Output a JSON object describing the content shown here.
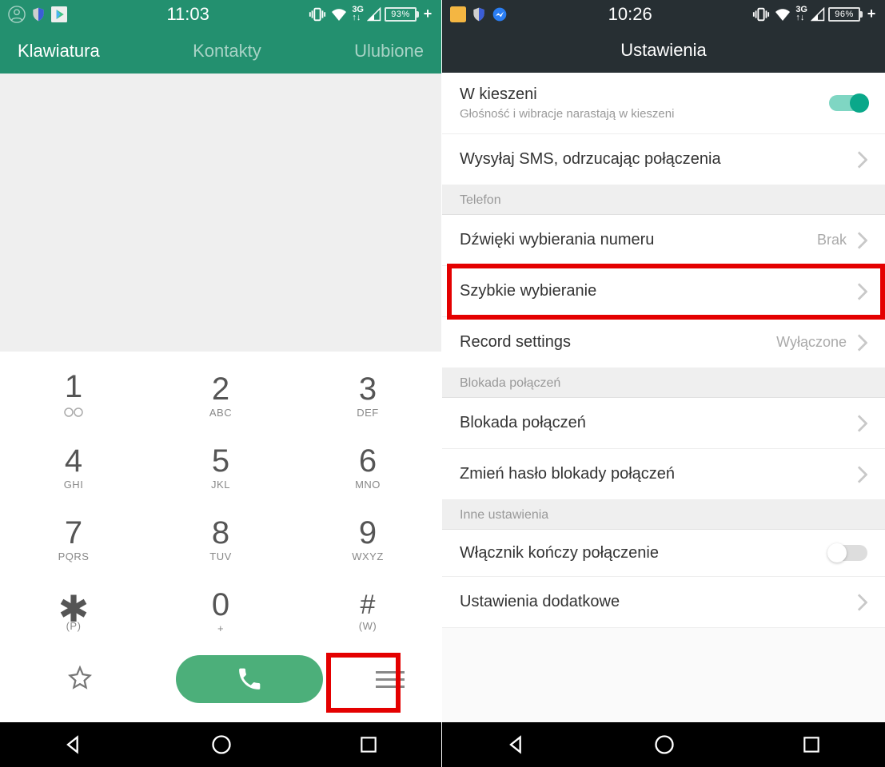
{
  "left": {
    "status": {
      "time": "11:03",
      "battery": "93%"
    },
    "tabs": {
      "t1": "Klawiatura",
      "t2": "Kontakty",
      "t3": "Ulubione"
    },
    "keypad": {
      "k1": {
        "n": "1",
        "s": ""
      },
      "k2": {
        "n": "2",
        "s": "ABC"
      },
      "k3": {
        "n": "3",
        "s": "DEF"
      },
      "k4": {
        "n": "4",
        "s": "GHI"
      },
      "k5": {
        "n": "5",
        "s": "JKL"
      },
      "k6": {
        "n": "6",
        "s": "MNO"
      },
      "k7": {
        "n": "7",
        "s": "PQRS"
      },
      "k8": {
        "n": "8",
        "s": "TUV"
      },
      "k9": {
        "n": "9",
        "s": "WXYZ"
      },
      "kstar": {
        "n": "✱",
        "s": "(P)"
      },
      "k0": {
        "n": "0",
        "s": "+"
      },
      "khash": {
        "n": "#",
        "s": "(W)"
      }
    }
  },
  "right": {
    "status": {
      "time": "10:26",
      "battery": "96%"
    },
    "header": "Ustawienia",
    "items": {
      "pocket": {
        "title": "W kieszeni",
        "sub": "Głośność i wibracje narastają w kieszeni"
      },
      "sms": {
        "title": "Wysyłaj SMS, odrzucając połączenia"
      },
      "sec_phone": "Telefon",
      "dialtones": {
        "title": "Dźwięki wybierania numeru",
        "value": "Brak"
      },
      "speeddial": {
        "title": "Szybkie wybieranie"
      },
      "record": {
        "title": "Record settings",
        "value": "Wyłączone"
      },
      "sec_block": "Blokada połączeń",
      "block": {
        "title": "Blokada połączeń"
      },
      "blockpw": {
        "title": "Zmień hasło blokady połączeń"
      },
      "sec_other": "Inne ustawienia",
      "powerend": {
        "title": "Włącznik kończy połączenie"
      },
      "extra": {
        "title": "Ustawienia dodatkowe"
      }
    }
  }
}
